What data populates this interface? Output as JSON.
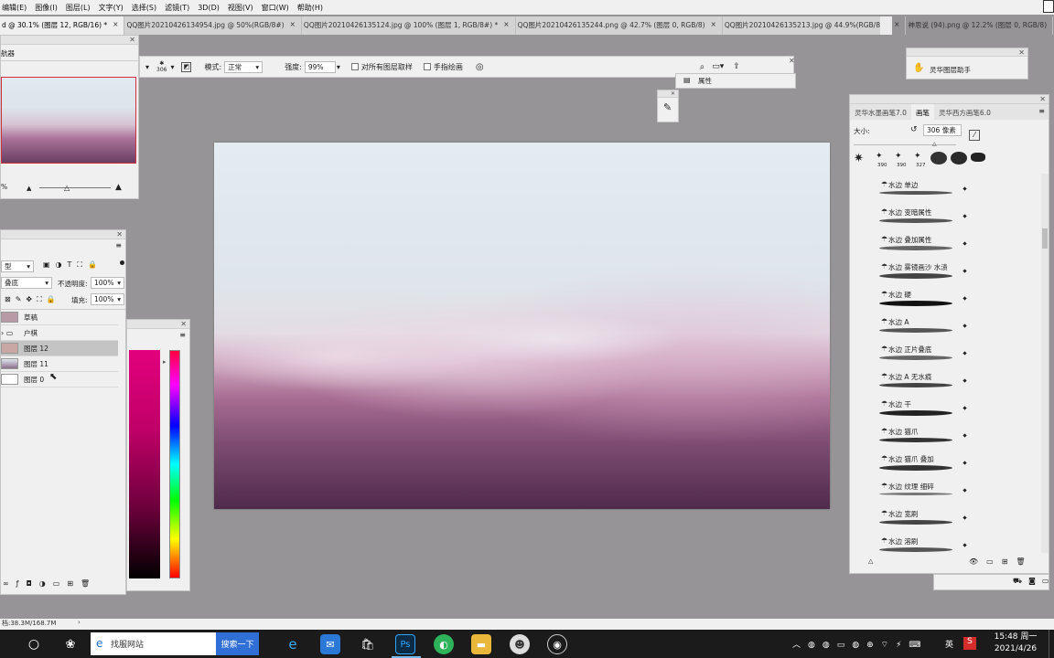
{
  "menu": [
    "编辑(E)",
    "图像(I)",
    "图层(L)",
    "文字(Y)",
    "选择(S)",
    "滤镜(T)",
    "3D(D)",
    "视图(V)",
    "窗口(W)",
    "帮助(H)"
  ],
  "tabs": [
    {
      "label": "d @ 30.1% (图层 12, RGB/16) *",
      "active": true
    },
    {
      "label": "QQ图片20210426134954.jpg @ 50%(RGB/8#)",
      "active": false
    },
    {
      "label": "QQ图片20210426135124.jpg @ 100% (图层 1, RGB/8#) *",
      "active": false
    },
    {
      "label": "QQ图片20210426135244.png @ 42.7% (图层 0, RGB/8)",
      "active": false
    },
    {
      "label": "QQ图片20210426135213.jpg @ 44.9%(RGB/8#)",
      "active": false
    },
    {
      "label": "神思说 (94).png @ 12.2% (图层 0, RGB/8)",
      "active": false
    }
  ],
  "options": {
    "brush_size": "306",
    "mode_label": "模式:",
    "mode_value": "正常",
    "strength_label": "强度:",
    "strength_value": "99%",
    "sample_all_label": "对所有图层取样",
    "finger_paint_label": "手指绘画"
  },
  "navigator": {
    "title": "航器",
    "zoom": "%"
  },
  "properties_label": "属性",
  "plugin_label": "灵华图层助手",
  "layers": {
    "kind": "型",
    "blend": "叠底",
    "opacity_label": "不透明度:",
    "opacity_value": "100%",
    "lock_label": "锁定:",
    "fill_label": "填充:",
    "fill_value": "100%",
    "rows": [
      {
        "name": "草稿",
        "selected": false
      },
      {
        "name": "户棋",
        "selected": false
      },
      {
        "name": "图层 12",
        "selected": true
      },
      {
        "name": "图层 11",
        "selected": false
      },
      {
        "name": "图层 0",
        "selected": false
      }
    ]
  },
  "brush_panel": {
    "tabs": [
      "灵华水墨画笔7.0",
      "画笔",
      "灵华西方画笔6.0"
    ],
    "size_label": "大小:",
    "size_value": "306 像素",
    "presets": [
      "390",
      "390",
      "327"
    ],
    "brushes": [
      "水边 单边",
      "水边 变暗属性",
      "水边 叠加属性",
      "水边 雾镜画沙 水渍",
      "水边 硬",
      "水边 A",
      "水边 正片叠底",
      "水边 A 无水痕",
      "水边 干",
      "水边 猫爪",
      "水边 猫爪 叠加",
      "水边 纹理 细碎",
      "水边 宽刷",
      "水边 溶刷"
    ]
  },
  "status_bar": "档:38.3M/168.7M",
  "taskbar": {
    "search_text": "找服网站",
    "search_button": "搜索一下",
    "ime": "英",
    "time": "15:48 周一",
    "date": "2021/4/26"
  },
  "colors": {
    "accent": "#2f6fd6",
    "selected_row": "#c4c4c4",
    "canvas_dark": "#4f2a4c"
  }
}
